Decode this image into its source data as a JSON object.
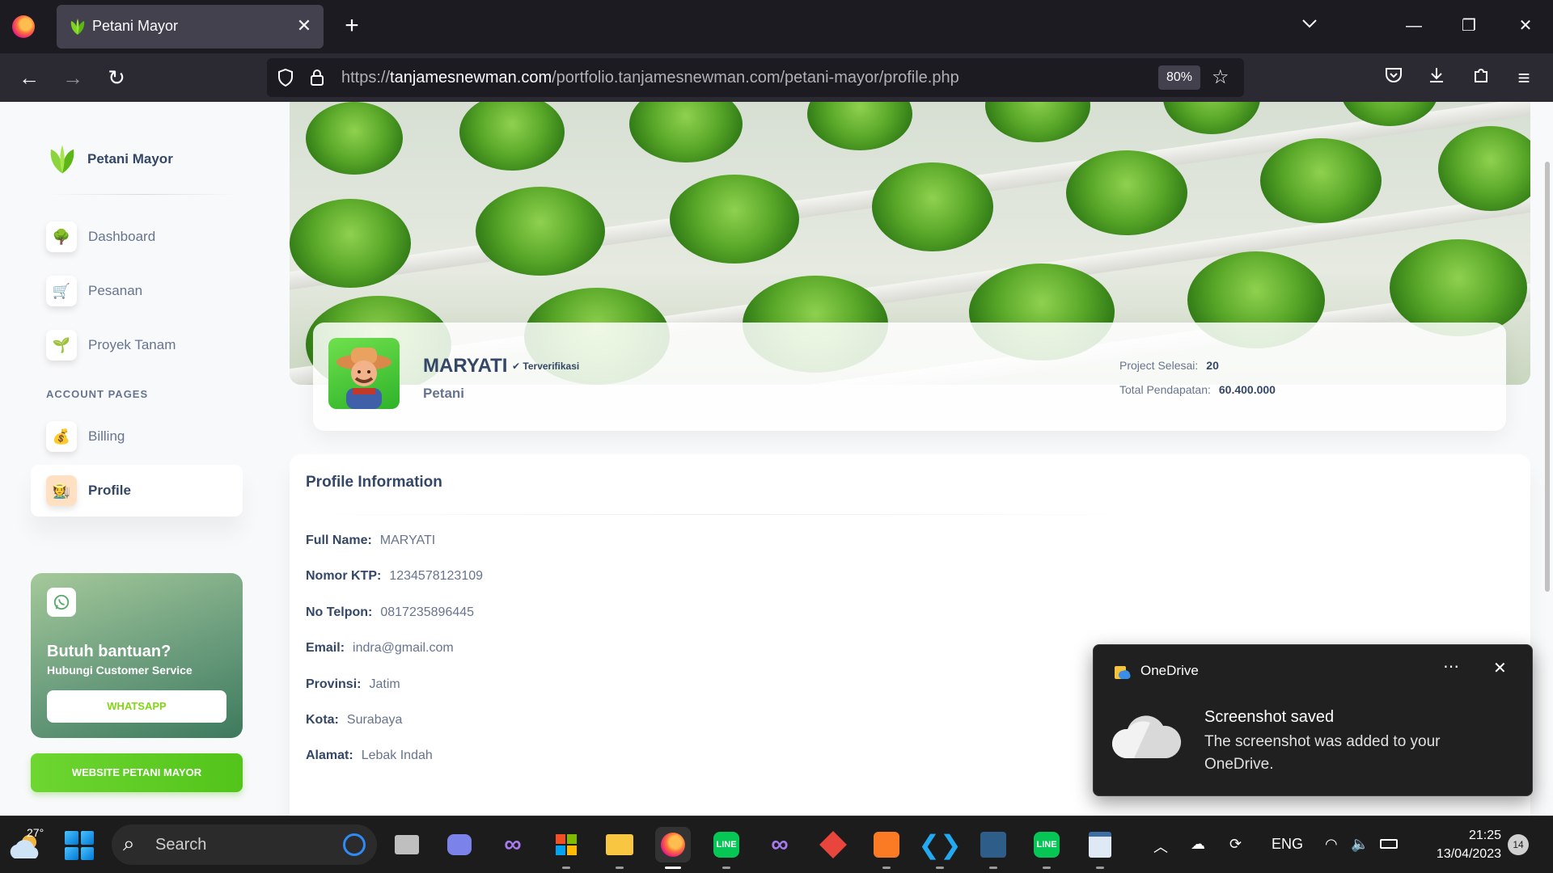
{
  "browser": {
    "tab_title": "Petani Mayor",
    "url_prefix": "https://",
    "url_domain": "tanjamesnewman.com",
    "url_path": "/portfolio.tanjamesnewman.com/petani-mayor/profile.php",
    "zoom": "80%"
  },
  "sidebar": {
    "brand": "Petani Mayor",
    "items": [
      {
        "label": "Dashboard",
        "icon": "tree-icon"
      },
      {
        "label": "Pesanan",
        "icon": "cart-icon"
      },
      {
        "label": "Proyek Tanam",
        "icon": "plant-icon"
      }
    ],
    "section_title": "ACCOUNT PAGES",
    "account_items": [
      {
        "label": "Billing",
        "icon": "billing-icon"
      },
      {
        "label": "Profile",
        "icon": "profile-icon",
        "active": true
      }
    ],
    "help": {
      "title": "Butuh bantuan?",
      "subtitle": "Hubungi Customer Service",
      "button": "WHATSAPP"
    },
    "website_button": "WEBSITE PETANI MAYOR"
  },
  "profile": {
    "name": "MARYATI",
    "verified": "Terverifikasi",
    "role": "Petani",
    "stats": [
      {
        "label": "Project Selesai:",
        "value": "20"
      },
      {
        "label": "Total Pendapatan:",
        "value": "60.400.000"
      }
    ]
  },
  "info": {
    "title": "Profile Information",
    "rows": [
      {
        "key": "Full Name:",
        "value": "MARYATI"
      },
      {
        "key": "Nomor KTP:",
        "value": "1234578123109"
      },
      {
        "key": "No Telpon:",
        "value": "0817235896445"
      },
      {
        "key": "Email:",
        "value": "indra@gmail.com"
      },
      {
        "key": "Provinsi:",
        "value": "Jatim"
      },
      {
        "key": "Kota:",
        "value": "Surabaya"
      },
      {
        "key": "Alamat:",
        "value": "Lebak Indah"
      }
    ]
  },
  "toast": {
    "app": "OneDrive",
    "title": "Screenshot saved",
    "body": "The screenshot was added to your OneDrive."
  },
  "taskbar": {
    "temperature": "27°",
    "search_placeholder": "Search",
    "language": "ENG",
    "time": "21:25",
    "date": "13/04/2023",
    "notification_count": "14"
  },
  "colors": {
    "primary_text": "#344767",
    "secondary_text": "#67748e",
    "accent_green": "#82d616",
    "browser_dark": "#1c1b22"
  }
}
